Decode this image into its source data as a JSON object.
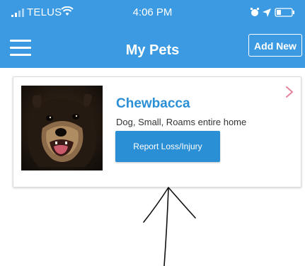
{
  "status_bar": {
    "carrier": "TELUS",
    "time": "4:06 PM",
    "icons": [
      "signal-icon",
      "wifi-icon",
      "alarm-icon",
      "location-icon",
      "battery-icon"
    ]
  },
  "header": {
    "title": "My Pets",
    "add_new_label": "Add New",
    "menu_icon": "hamburger-menu-icon"
  },
  "pets": [
    {
      "name": "Chewbacca",
      "details": "Dog, Small, Roams entire home",
      "report_label": "Report Loss/Injury"
    }
  ],
  "colors": {
    "header_bg": "#3b9ae1",
    "accent": "#2b8fd6",
    "chevron": "#e8829b"
  }
}
